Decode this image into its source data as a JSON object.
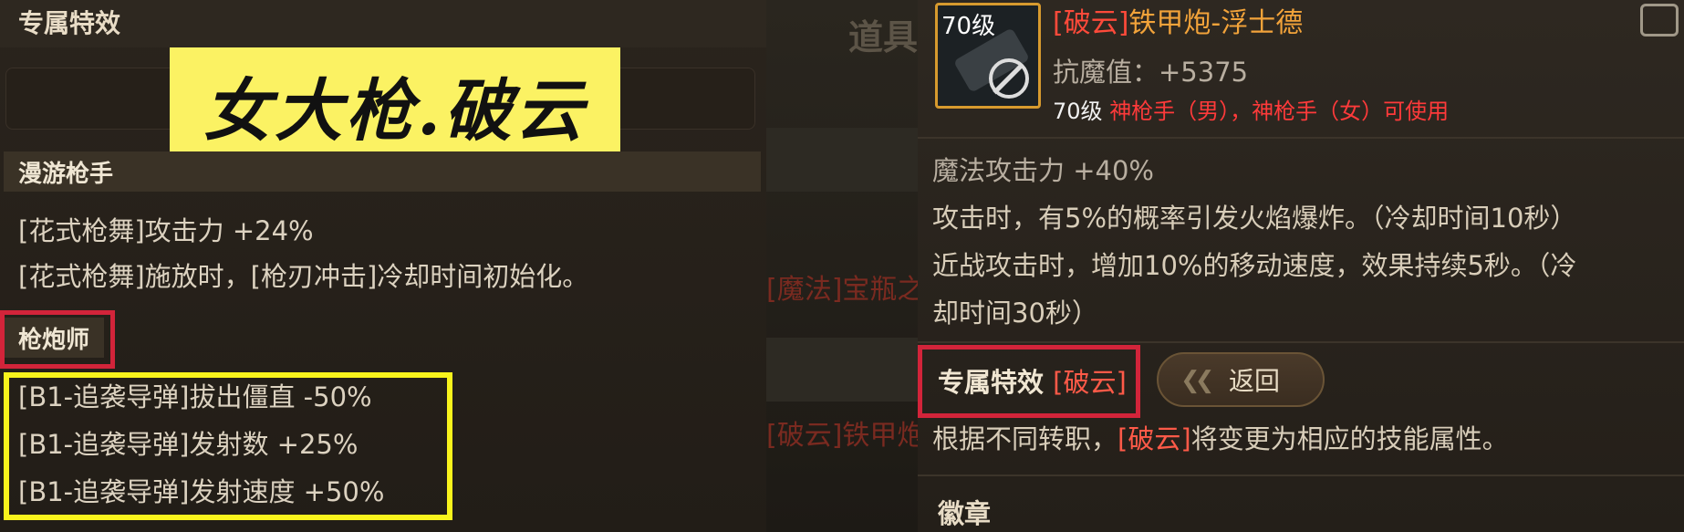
{
  "left": {
    "title": "专属特效",
    "yellow_tag": "女大枪.破云",
    "section1": "漫游枪手",
    "lines1": [
      "[花式枪舞]攻击力 +24%",
      "[花式枪舞]施放时，[枪刃冲击]冷却时间初始化。"
    ],
    "section2": "枪炮师",
    "lines2": [
      "[B1-追袭导弹]拔出僵直 -50%",
      "[B1-追袭导弹]发射数 +25%",
      "[B1-追袭导弹]发射速度 +50%"
    ]
  },
  "middle": {
    "tab": "道具",
    "texts": [
      "[魔法]宝瓶之守",
      "[破云]铁甲炮-"
    ]
  },
  "right": {
    "item_level": "70级",
    "item_name_bracket": "[破云]",
    "item_name": "铁甲炮-浮士德",
    "stat": "抗魔值：+5375",
    "req_level": "70级",
    "req_classes": "神枪手（男），神枪手（女）可使用",
    "lines": [
      "魔法攻击力 +40%",
      "攻击时，有5%的概率引发火焰爆炸。（冷却时间10秒）",
      "近战攻击时，增加10%的移动速度，效果持续5秒。（冷",
      "却时间30秒）"
    ],
    "spec_label": "专属特效",
    "spec_tag": "[破云]",
    "back": "返回",
    "desc_pre": "根据不同转职，",
    "desc_tag": "[破云]",
    "desc_post": "将变更为相应的技能属性。",
    "badge": "徽章"
  },
  "colors": {
    "highlight_yellow": "#fbf263",
    "frame_red": "#d2243a",
    "frame_yellow": "#f8f31c",
    "item_orange": "#f2a33a"
  }
}
